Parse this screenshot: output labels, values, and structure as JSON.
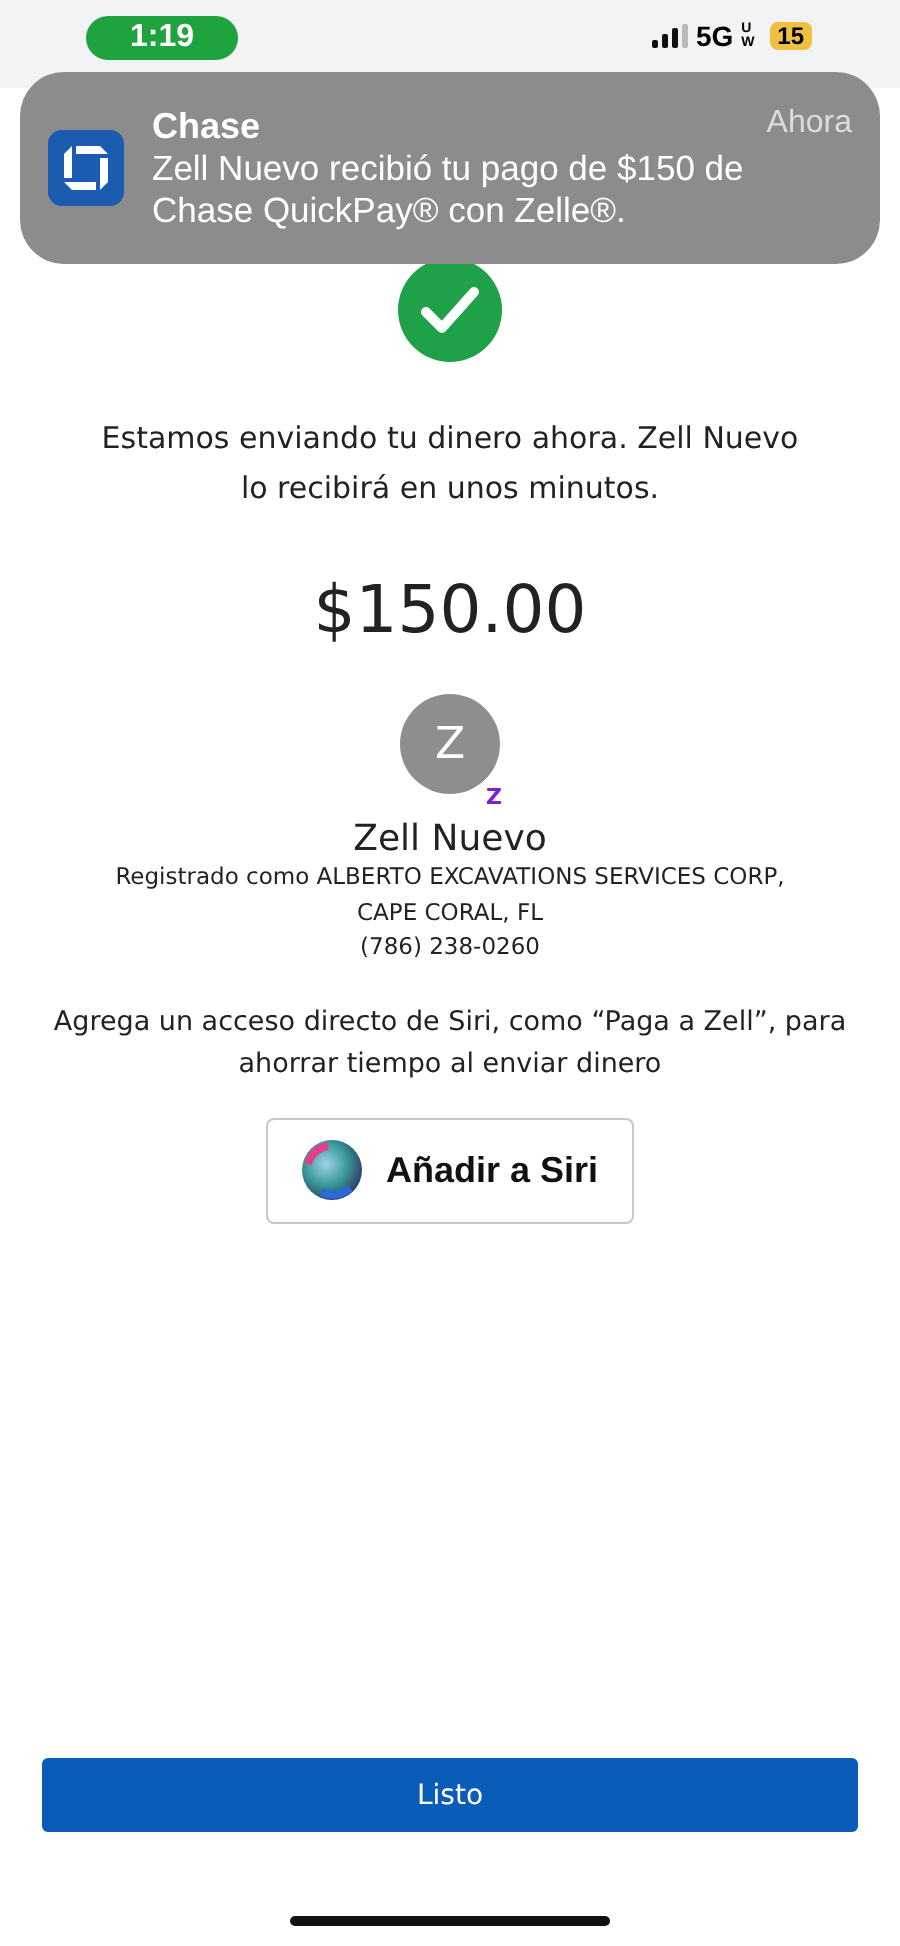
{
  "status_bar": {
    "time": "1:19",
    "network": "5G",
    "network_badge": "UW",
    "battery": "15"
  },
  "notification": {
    "app": "Chase",
    "time": "Ahora",
    "message": "Zell Nuevo recibió tu pago de $150 de Chase QuickPay® con Zelle®."
  },
  "confirmation": {
    "message": "Estamos enviando tu dinero ahora. Zell Nuevo lo recibirá en unos minutos.",
    "amount": "$150.00"
  },
  "recipient": {
    "initial": "Z",
    "badge": "Z",
    "name": "Zell Nuevo",
    "details": [
      "Registrado como ALBERTO EXCAVATIONS SERVICES CORP,",
      "CAPE CORAL, FL",
      "(786) 238-0260"
    ]
  },
  "siri": {
    "prompt": "Agrega un acceso directo de Siri, como “Paga a Zell”, para ahorrar tiempo al enviar dinero",
    "button": "Añadir a Siri"
  },
  "done_button": "Listo"
}
